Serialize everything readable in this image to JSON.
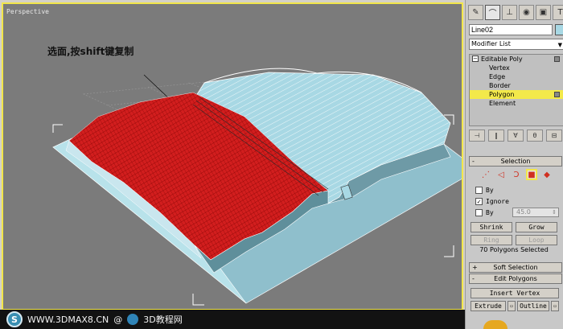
{
  "viewport": {
    "label": "Perspective",
    "annotation": "选面,按shift键复制",
    "colors": {
      "background": "#7b7b7b",
      "selected_polygons": "#d21e1e",
      "model_surface": "#a8d8e4",
      "model_wire": "#ffffff",
      "active_border": "#f2e64a"
    }
  },
  "watermark": {
    "logo_icon": "swirl-logo-icon",
    "url": "WWW.3DMAX8.CN",
    "at": "@",
    "name": "3D教程网"
  },
  "panel": {
    "tabs": [
      {
        "icon": "create-icon",
        "glyph": "✎"
      },
      {
        "icon": "modify-icon",
        "glyph": "⌒"
      },
      {
        "icon": "hierarchy-icon",
        "glyph": "⊥"
      },
      {
        "icon": "motion-icon",
        "glyph": "◉"
      },
      {
        "icon": "display-icon",
        "glyph": "▣"
      },
      {
        "icon": "utilities-icon",
        "glyph": "T"
      }
    ],
    "object_name": "Line02",
    "object_color": "#a8d8e4",
    "modifier_list": "Modifier List",
    "stack": {
      "root": "Editable Poly",
      "items": [
        "Vertex",
        "Edge",
        "Border",
        "Polygon",
        "Element"
      ],
      "selected": "Polygon"
    },
    "stack_tools": [
      {
        "icon": "pin-stack-icon",
        "glyph": "⊣"
      },
      {
        "icon": "show-end-result-icon",
        "glyph": "‖"
      },
      {
        "icon": "make-unique-icon",
        "glyph": "∀"
      },
      {
        "icon": "remove-modifier-icon",
        "glyph": "θ"
      },
      {
        "icon": "configure-sets-icon",
        "glyph": "⊟"
      }
    ],
    "selection": {
      "title": "Selection",
      "sign": "-",
      "subobject_icons": [
        {
          "icon": "vertex-mode-icon",
          "glyph": "⋰"
        },
        {
          "icon": "edge-mode-icon",
          "glyph": "◁"
        },
        {
          "icon": "border-mode-icon",
          "glyph": "Ↄ"
        },
        {
          "icon": "polygon-mode-icon",
          "glyph": "■"
        },
        {
          "icon": "element-mode-icon",
          "glyph": "◆"
        }
      ],
      "by_vertex_label": "By",
      "ignore_backfacing_label": "Ignore",
      "by_angle_label": "By",
      "angle_value": "45.0",
      "shrink_label": "Shrink",
      "grow_label": "Grow",
      "ring_label": "Ring",
      "loop_label": "Loop",
      "status": "70 Polygons Selected"
    },
    "soft_selection": {
      "title": "Soft Selection",
      "sign": "+"
    },
    "edit_polygons": {
      "title": "Edit Polygons",
      "sign": "-",
      "insert_vertex_label": "Insert Vertex",
      "extrude_label": "Extrude",
      "outline_label": "Outline"
    }
  }
}
